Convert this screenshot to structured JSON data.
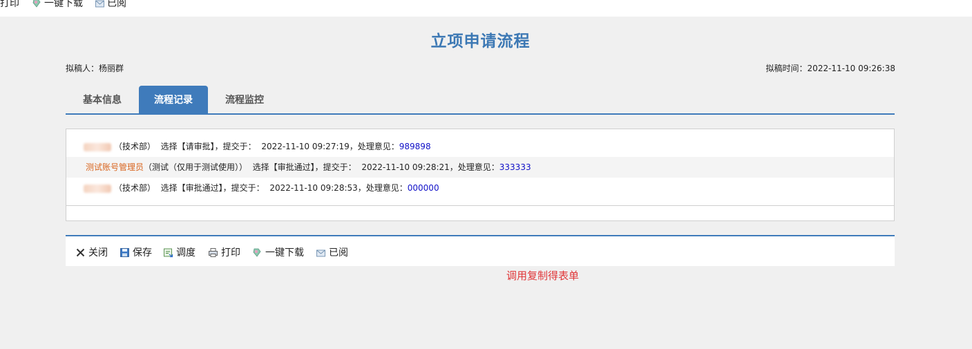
{
  "top_toolbar": {
    "print_label": "打印",
    "download_label": "一键下载",
    "read_label": "已阅"
  },
  "header": {
    "title": "立项申请流程",
    "drafter_label": "拟稿人：",
    "drafter_name": "杨丽群",
    "draft_time_label": "拟稿时间：",
    "draft_time": "2022-11-10 09:26:38"
  },
  "tabs": [
    {
      "label": "基本信息",
      "active": false
    },
    {
      "label": "流程记录",
      "active": true
    },
    {
      "label": "流程监控",
      "active": false
    }
  ],
  "records": [
    {
      "name": "",
      "dept": "（技术部）",
      "select_text": "选择【请审批】，提交于：",
      "time": "2022-11-10 09:27:19，处理意见：",
      "opinion": "989898"
    },
    {
      "name": "测试账号管理员",
      "dept": "（测试（仅用于测试使用））",
      "select_text": "选择【审批通过】，提交于：",
      "time": "2022-11-10 09:28:21，处理意见：",
      "opinion": "333333"
    },
    {
      "name": "",
      "dept": "（技术部）",
      "select_text": "选择【审批通过】，提交于：",
      "time": "2022-11-10 09:28:53，处理意见：",
      "opinion": "000000"
    }
  ],
  "bottom_toolbar": {
    "close_label": "关闭",
    "save_label": "保存",
    "dispatch_label": "调度",
    "print_label": "打印",
    "download_label": "一键下载",
    "read_label": "已阅"
  },
  "note": "调用复制得表单",
  "colors": {
    "accent": "#3f7bbb",
    "title": "#3c78b4",
    "name_highlight": "#d9651f",
    "opinion": "#1010c8",
    "note": "#e0383a"
  }
}
